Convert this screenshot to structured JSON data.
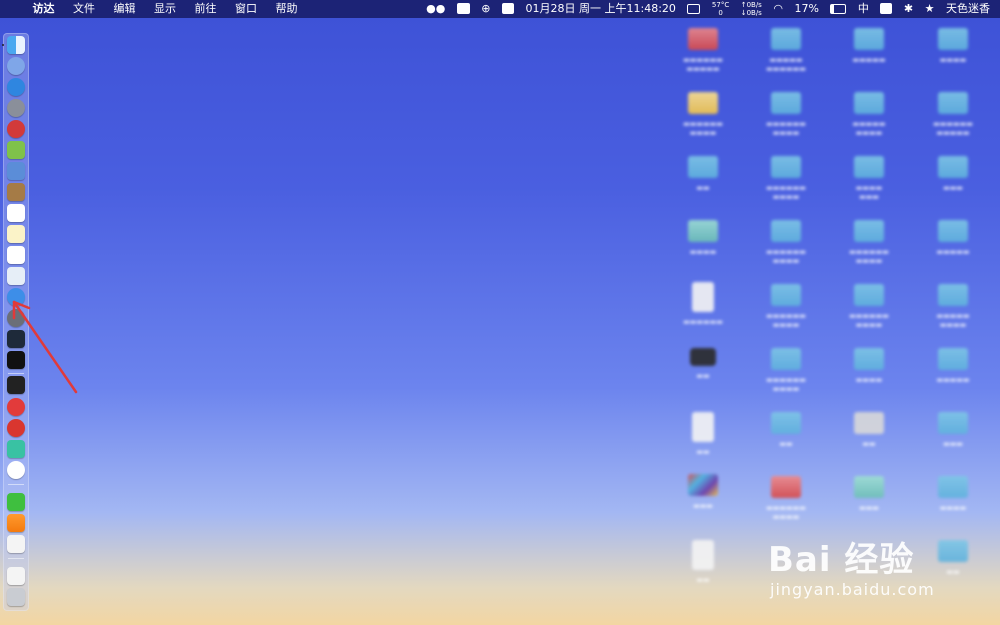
{
  "menubar": {
    "apple_icon": "apple-icon",
    "app_name": "访达",
    "menus": [
      "文件",
      "编辑",
      "显示",
      "前往",
      "窗口",
      "帮助"
    ],
    "cpu_temp_top": "57°C",
    "cpu_temp_bottom": "0",
    "net_up": "↑0B/s",
    "net_down": "↓0B/s",
    "datetime": "01月28日 周一 上午11:48:20",
    "battery": "17%",
    "input_method": "中",
    "user": "天色迷香"
  },
  "watermark": {
    "brand": "Bai 经验",
    "url": "jingyan.baidu.com"
  },
  "colors": {
    "menubar_bg": "#19206e",
    "arrow": "#e03a3a",
    "desktop_top": "#3d51d6",
    "desktop_bottom": "#f3d6a2"
  }
}
